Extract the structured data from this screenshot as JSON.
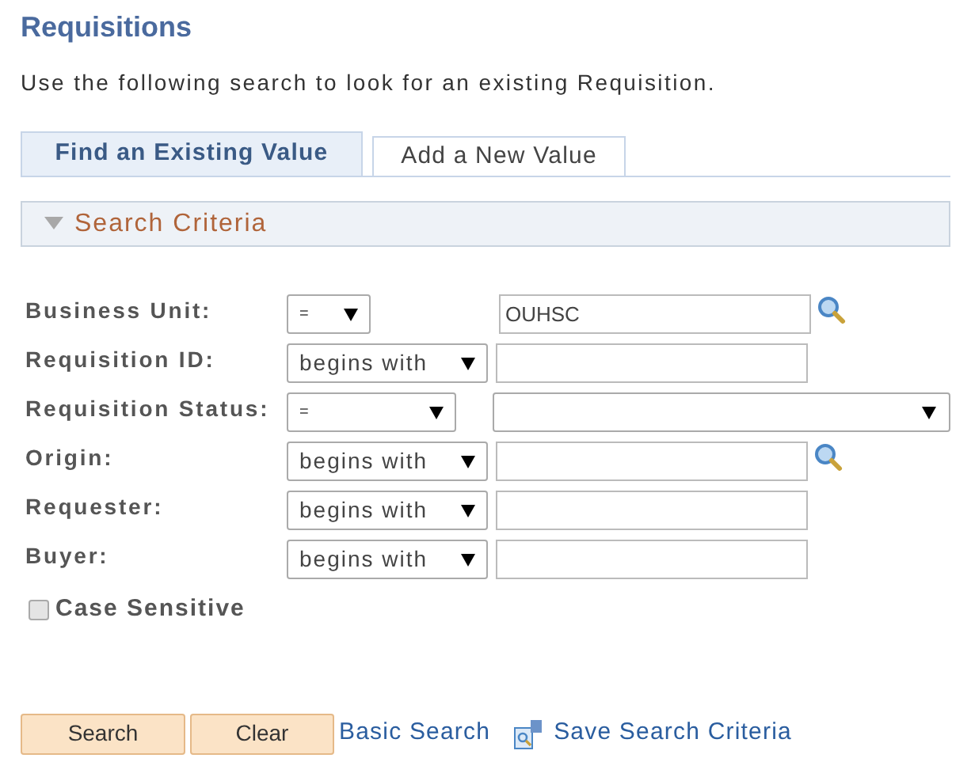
{
  "title": "Requisitions",
  "description": "Use the following search to look for an existing Requisition.",
  "tabs": [
    {
      "label": "Find an Existing Value",
      "selected": true
    },
    {
      "label": "Add a New Value",
      "selected": false
    }
  ],
  "section": {
    "label": "Search Criteria",
    "expanded": true
  },
  "fields": [
    {
      "kind": "unit",
      "label": "Business Unit:",
      "operator": "=",
      "value": "OUHSC",
      "lookup": true
    },
    {
      "kind": "text",
      "label": "Requisition ID:",
      "operator": "begins with",
      "lookup": false
    },
    {
      "kind": "status",
      "label": "Requisition Status:",
      "operator": "=",
      "lookup": false
    },
    {
      "kind": "text",
      "label": "Origin:",
      "operator": "begins with",
      "lookup": true
    },
    {
      "kind": "text",
      "label": "Requester:",
      "operator": "begins with",
      "lookup": false
    },
    {
      "kind": "text",
      "label": "Buyer:",
      "operator": "begins with",
      "lookup": false
    }
  ],
  "case_sensitive": {
    "label": "Case Sensitive",
    "checked": false
  },
  "buttons": [
    "Search",
    "Clear"
  ],
  "links": [
    {
      "label": "Basic Search",
      "icon": false
    },
    {
      "label": "Save Search Criteria",
      "icon": true
    }
  ]
}
